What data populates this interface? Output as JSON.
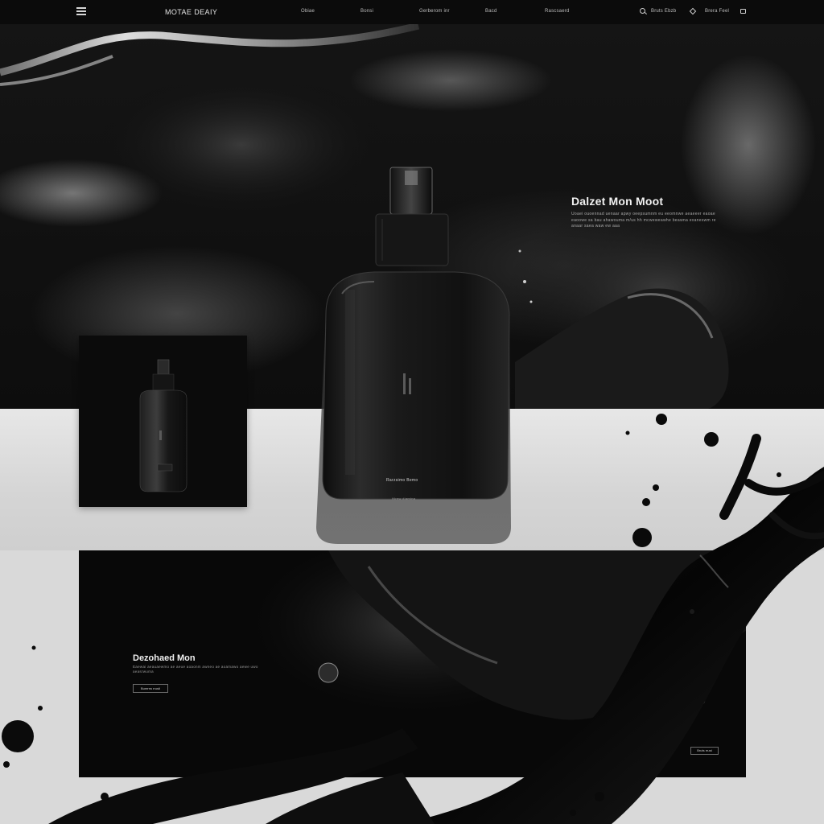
{
  "nav": {
    "brand": "MOTAE DEAIY",
    "links": [
      "Obiae",
      "Bonsi",
      "Gerberom inr",
      "Bacd",
      "Rascsaerd"
    ],
    "account_label": "Bruts Ebzb",
    "lang_label": "Brera Feel"
  },
  "hero": {
    "title": "Dalzet Mon Moot",
    "description": "Uoaei ouoennad uenaar apwy oeepsumnm eu eeomnwe aeaeeer eaoae eaoowe sa bau ahawouma m/us hh mcweweawhe beawna exaneswm re anaar saea waw ew aaa"
  },
  "bottle": {
    "label": "Rarzsimo Bemo",
    "sub_label": "Hirnw diamina"
  },
  "panel": {
    "title": "Dezohaed Mon",
    "description": "Eaewai aeauaewmo ae aeue aoaonm awneo ae aoamawo aewe uwo aeasrwuma",
    "cta_label": "Burerrw rrusti",
    "cta2_label": "Bruts rrust"
  },
  "colors": {
    "nav_bg": "#0b0b0b",
    "hero_bg": "#111111",
    "band_bg": "#dcdcdc",
    "panel_bg": "#080808",
    "accent": "#f2f2f2"
  }
}
